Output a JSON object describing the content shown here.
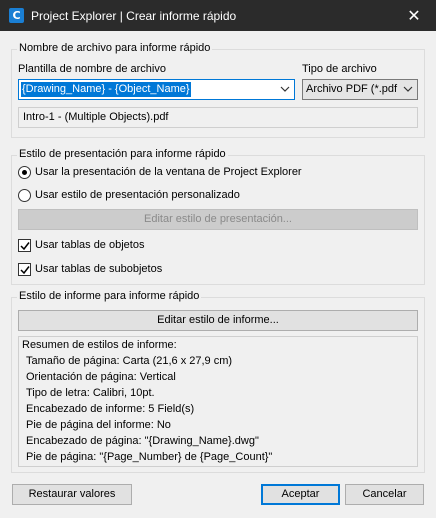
{
  "window": {
    "title": "Project Explorer | Crear informe rápido",
    "app_icon": "autodesk-civil-icon",
    "close_glyph": "✕"
  },
  "filename_group": {
    "legend": "Nombre de archivo para informe rápido",
    "template_label": "Plantilla de nombre de archivo",
    "template_value": "{Drawing_Name} - {Object_Name}",
    "type_label": "Tipo de archivo",
    "type_value": "Archivo PDF (*.pdf",
    "preview": "Intro-1 - (Multiple Objects).pdf"
  },
  "presentation_group": {
    "legend": "Estilo de presentación para informe rápido",
    "radio_window": "Usar la presentación de la ventana de Project Explorer",
    "radio_custom": "Usar estilo de presentación personalizado",
    "edit_button": "Editar estilo de presentación...",
    "check_object_tables": "Usar tablas de objetos",
    "check_subobject_tables": "Usar tablas de subobjetos"
  },
  "report_group": {
    "legend": "Estilo de informe para informe rápido",
    "edit_button": "Editar estilo de informe...",
    "summary": [
      "Resumen de estilos de informe:",
      "Tamaño de página: Carta (21,6 x 27,9 cm)",
      "Orientación de página: Vertical",
      "Tipo de letra: Calibri, 10pt.",
      "Encabezado de informe: 5 Field(s)",
      "Pie de página del informe: No",
      "Encabezado de página: \"{Drawing_Name}.dwg\"",
      "Pie de página: \"{Page_Number} de {Page_Count}\""
    ]
  },
  "footer": {
    "restore": "Restaurar valores",
    "accept": "Aceptar",
    "cancel": "Cancelar"
  },
  "colors": {
    "titlebar": "#2b2b2b",
    "accent": "#0078d7"
  }
}
